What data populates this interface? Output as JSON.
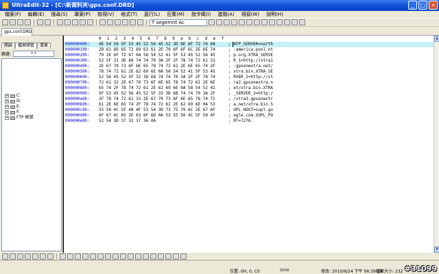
{
  "window": {
    "title": "UltraEdit-32 - [C:\\新資料夾\\gps.conf.DRD]",
    "buttons": {
      "minimize": "_",
      "maximize": "□",
      "close": "×"
    }
  },
  "menu": [
    "檔案(F)",
    "編輯(E)",
    "搜尋(S)",
    "專案(P)",
    "檢視(V)",
    "格式(T)",
    "直行(L)",
    "巨集(M)",
    "指令碼(I)",
    "進階(A)",
    "視窗(W)",
    "說明(H)"
  ],
  "toolbar": {
    "font_dropdown": "T segemnt Ac"
  },
  "file_tab": "gps.conf.DRD",
  "left_pane": {
    "tabs": [
      "開啟",
      "檔案總管",
      "清單"
    ],
    "filter_label": "篩選:",
    "filter_value": "*.*",
    "tree": [
      {
        "expander": "+",
        "label": "C:"
      },
      {
        "expander": "+",
        "label": "D:"
      },
      {
        "expander": "+",
        "label": "E:"
      },
      {
        "expander": "+",
        "label": "F:"
      },
      {
        "expander": "+",
        "label": "FTP 帳號"
      }
    ]
  },
  "editor": {
    "ruler": [
      "0",
      "1",
      "2",
      "3",
      "4",
      "5",
      "6",
      "7",
      "8",
      "9",
      "a",
      "b",
      "c",
      "d",
      "e",
      "f"
    ],
    "rows": [
      {
        "addr": "00000000h:",
        "hex": "4E 54 50 5F 53 45 52 56 45 52 3D 6E 6F 72 74 68",
        "ascii": "; NTP_SERVER=north"
      },
      {
        "addr": "00000010h:",
        "hex": "2D 61 6D 65 72 69 63 61 2E 70 6F 6F 6C 2E 6E 74",
        "ascii": "; -america.pool.nt"
      },
      {
        "addr": "00000020h:",
        "hex": "70 2E 6F 72 67 0A 58 54 52 41 5F 53 45 52 56 45",
        "ascii": "; p.org.XTRA_SERVE"
      },
      {
        "addr": "00000030h:",
        "hex": "52 5F 31 3D 68 74 74 70 3A 2F 2F 78 74 72 61 31",
        "ascii": "; R_1=http://xtra1"
      },
      {
        "addr": "00000040h:",
        "hex": "2E 67 70 73 6F 6E 65 78 74 72 61 2E 6E 65 74 2F",
        "ascii": "; .gpsonextra.net/"
      },
      {
        "addr": "00000050h:",
        "hex": "78 74 72 61 2E 62 69 6E 0A 58 54 52 41 5F 53 45",
        "ascii": "; xtra.bin.XTRA_SE"
      },
      {
        "addr": "00000060h:",
        "hex": "52 56 45 52 5F 32 3D 68 74 74 70 3A 2F 2F 78 74",
        "ascii": "; RVER_2=http://xt"
      },
      {
        "addr": "00000070h:",
        "hex": "72 61 32 2E 67 70 73 6F 6E 65 78 74 72 61 2E 6E",
        "ascii": "; ra2.gpsonextra.n"
      },
      {
        "addr": "00000080h:",
        "hex": "65 74 2F 78 74 72 61 2E 62 69 6E 0A 58 54 52 41",
        "ascii": "; et/xtra.bin.XTRA"
      },
      {
        "addr": "00000090h:",
        "hex": "5F 53 45 52 56 45 52 5F 33 3D 68 74 74 70 3A 2F",
        "ascii": "; _SERVER_3=http:/"
      },
      {
        "addr": "000000a0h:",
        "hex": "2F 78 74 72 61 33 2E 67 70 73 6F 6E 65 78 74 72",
        "ascii": "; /xtra3.gpsonextr"
      },
      {
        "addr": "000000b0h:",
        "hex": "61 2E 6E 65 74 2F 78 74 72 61 2E 62 69 6E 0A 53",
        "ascii": "; a.net/xtra.bin.S"
      },
      {
        "addr": "000000c0h:",
        "hex": "55 50 4C 5F 48 4F 53 54 3D 73 75 70 6C 2E 67 6F",
        "ascii": "; UPL_HOST=supl.go"
      },
      {
        "addr": "000000d0h:",
        "hex": "6F 67 6C 65 2E 63 6F 6D 0A 53 55 50 4C 5F 50 4F",
        "ascii": "; ogle.com.SUPL_PO"
      },
      {
        "addr": "000000e0h:",
        "hex": "52 54 3D 37 32 37 36 0A",
        "ascii": "; RT=7276."
      }
    ]
  },
  "status": {
    "position": "位置: 0H, 0, C0",
    "format": "Unix",
    "modified": "修改: 2010/6/24 下午 06:39:28",
    "filesize": "檔案大小: 232"
  },
  "watermark": "#31099"
}
